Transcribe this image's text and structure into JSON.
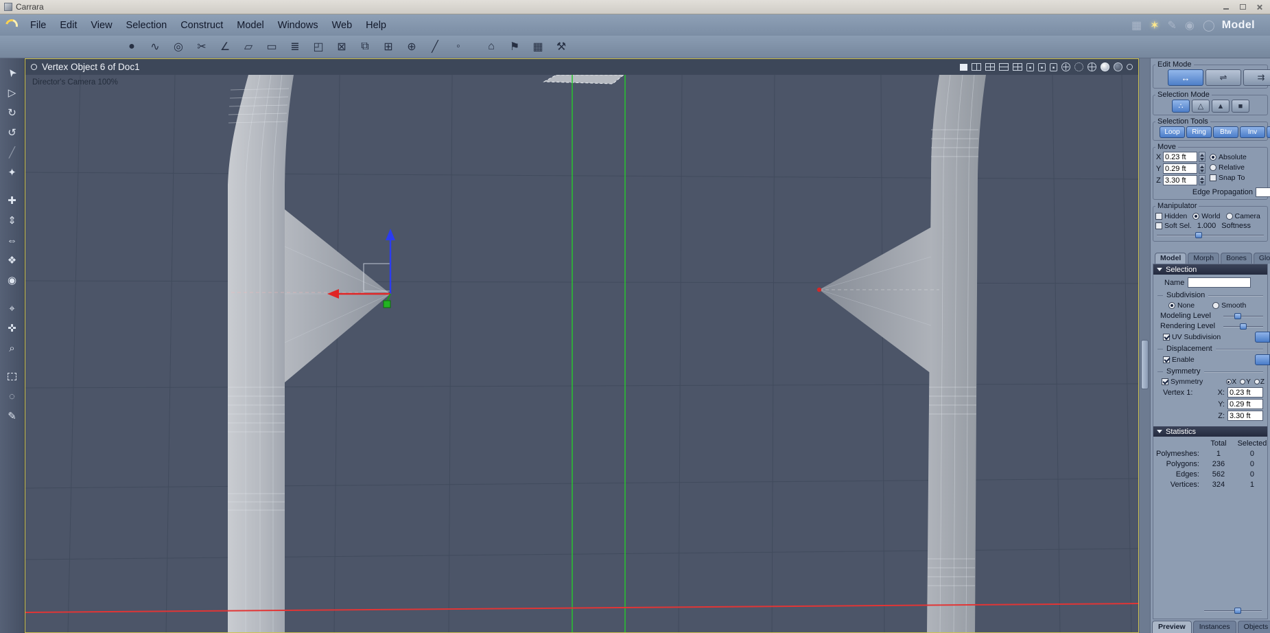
{
  "window": {
    "title": "Carrara",
    "mode_label": "Model"
  },
  "menus": [
    "File",
    "Edit",
    "View",
    "Selection",
    "Construct",
    "Model",
    "Windows",
    "Web",
    "Help"
  ],
  "viewport": {
    "title": "Vertex Object 6 of Doc1",
    "camera_label": "Director's Camera 100%"
  },
  "icons": {
    "toolbar": [
      "●",
      "∿",
      "◎",
      "✂",
      "∠",
      "▱",
      "▭",
      "≣",
      "◰",
      "⊠",
      "⧉",
      "⊞",
      "⊕",
      "╱",
      "◦",
      "⌂",
      "⚑",
      "▦",
      "⚒"
    ],
    "left": [
      "➤",
      "▷",
      "↻",
      "↺",
      "╱",
      "✦",
      "✚",
      "⇕",
      "⇔",
      "❖",
      "◉",
      "⌖",
      "✜",
      "⌕",
      "◌",
      "✎"
    ],
    "edit_mode": [
      "↔",
      "⇌",
      "⇉"
    ],
    "selection_mode": [
      "∴",
      "△",
      "▲",
      "■"
    ],
    "rooms": [
      "▦",
      "✶",
      "✎",
      "◉",
      "◯"
    ]
  },
  "panel": {
    "edit_mode_label": "Edit Mode",
    "selection_mode_label": "Selection Mode",
    "selection_tools_label": "Selection Tools",
    "selection_tools": [
      "Loop",
      "Ring",
      "Btw",
      "Inv"
    ],
    "move_label": "Move",
    "move_axes": [
      {
        "axis": "X",
        "value": "0.23 ft"
      },
      {
        "axis": "Y",
        "value": "0.29 ft"
      },
      {
        "axis": "Z",
        "value": "3.30 ft"
      }
    ],
    "move_options": [
      "Absolute",
      "Relative",
      "Snap To"
    ],
    "edge_propagation_label": "Edge Propagation",
    "manipulator_label": "Manipulator",
    "manipulator_options": [
      "Hidden",
      "World",
      "Camera"
    ],
    "soft_sel_label": "Soft Sel.",
    "soft_sel_value": "1.000",
    "softness_label": "Softness",
    "tabs": [
      "Model",
      "Morph",
      "Bones",
      "Global"
    ],
    "selection_header": "Selection",
    "name_label": "Name",
    "subdivision_label": "Subdivision",
    "subdivision_options": [
      "None",
      "Smooth"
    ],
    "modeling_level_label": "Modeling Level",
    "rendering_level_label": "Rendering Level",
    "uv_subdivision_label": "UV Subdivision",
    "displacement_label": "Displacement",
    "enable_label": "Enable",
    "symmetry_label": "Symmetry",
    "symmetry_checkbox_label": "Symmetry",
    "symmetry_axes": [
      "X",
      "Y",
      "Z"
    ],
    "vertex_label": "Vertex 1:",
    "vertex_fields": [
      {
        "axis": "X:",
        "value": "0.23 ft"
      },
      {
        "axis": "Y:",
        "value": "0.29 ft"
      },
      {
        "axis": "Z:",
        "value": "3.30 ft"
      }
    ],
    "statistics_header": "Statistics",
    "stats_columns": [
      "Total",
      "Selected"
    ],
    "stats_rows": [
      {
        "label": "Polymeshes:",
        "total": "1",
        "selected": "0"
      },
      {
        "label": "Polygons:",
        "total": "236",
        "selected": "0"
      },
      {
        "label": "Edges:",
        "total": "562",
        "selected": "0"
      },
      {
        "label": "Vertices:",
        "total": "324",
        "selected": "1"
      }
    ],
    "bottom_tabs": [
      "Preview",
      "Instances",
      "Objects"
    ]
  }
}
